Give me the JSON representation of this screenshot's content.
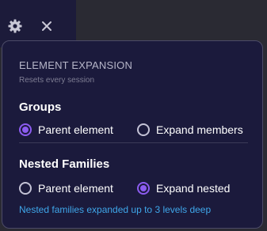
{
  "toolbar": {
    "settings_icon": "gear-icon",
    "close_icon": "close-icon"
  },
  "popover": {
    "title": "ELEMENT EXPANSION",
    "subtitle": "Resets every session",
    "groups": {
      "heading": "Groups",
      "options": [
        {
          "label": "Parent element",
          "selected": true
        },
        {
          "label": "Expand members",
          "selected": false
        }
      ]
    },
    "nested": {
      "heading": "Nested Families",
      "options": [
        {
          "label": "Parent element",
          "selected": false
        },
        {
          "label": "Expand nested",
          "selected": true
        }
      ],
      "note": "Nested families expanded up to 3 levels deep"
    }
  },
  "colors": {
    "accent": "#8c5cf0",
    "link": "#3fa7ea",
    "panel": "#1b1a3c"
  }
}
